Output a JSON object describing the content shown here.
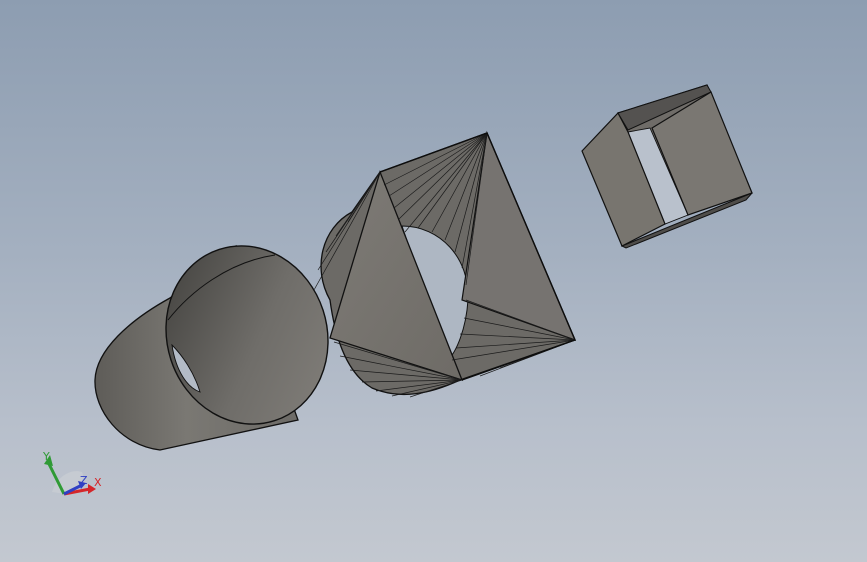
{
  "viewport": {
    "background_top": "#8d9db1",
    "background_bottom": "#c3c8d0",
    "model_color": "#77746f",
    "edge_color": "#111111"
  },
  "models": [
    {
      "kind": "cylinder-tube"
    },
    {
      "kind": "round-to-square-transition"
    },
    {
      "kind": "square-tube"
    }
  ],
  "triad": {
    "x_label": "X",
    "y_label": "Y",
    "z_label": "Z",
    "x_color": "#d4262a",
    "y_color": "#2f9a35",
    "z_color": "#2f3fc4"
  }
}
